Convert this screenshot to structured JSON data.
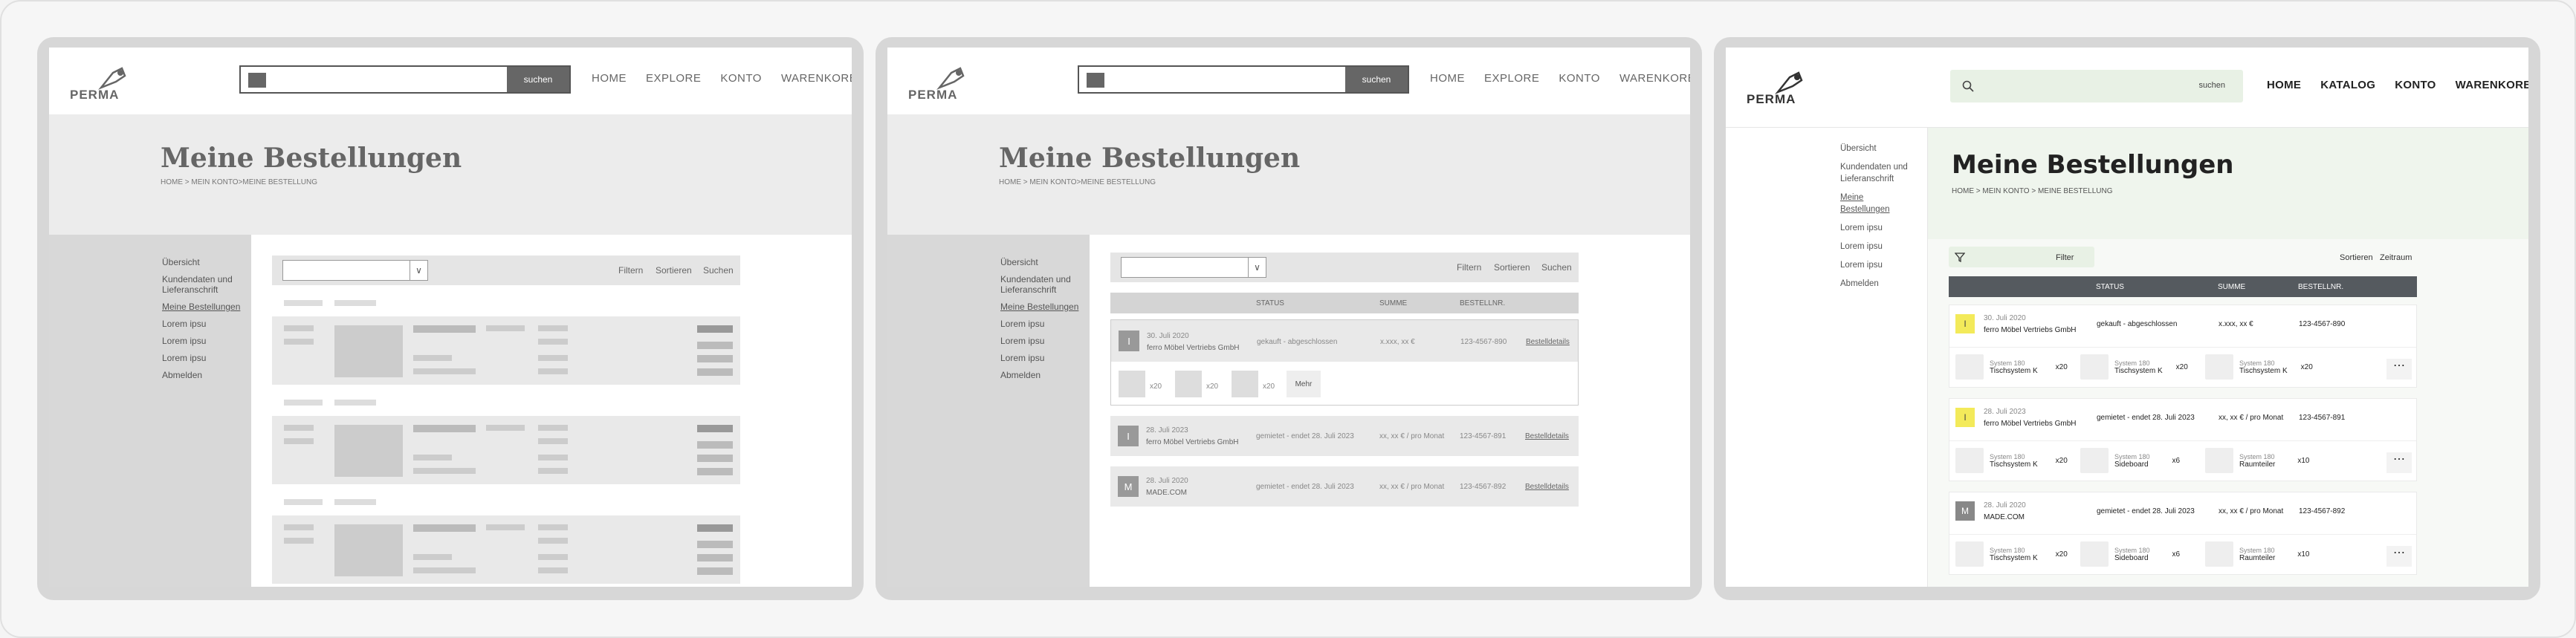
{
  "colors": {
    "accent_green": "#e8f1e5",
    "header_dark": "#555a5f",
    "badge_yellow": "#f3ea5a",
    "badge_gray": "#888888"
  },
  "brand": "PERMA",
  "search": {
    "button": "suchen"
  },
  "nav": [
    "HOME",
    "EXPLORE",
    "KONTO",
    "WARENKORB"
  ],
  "nav_final": [
    "HOME",
    "KATALOG",
    "KONTO",
    "WARENKORB"
  ],
  "page_title": "Meine Bestellungen",
  "breadcrumb": "HOME > MEIN KONTO>MEINE BESTELLUNG",
  "breadcrumb_final": "HOME > MEIN KONTO > MEINE BESTELLUNG",
  "sidebar": {
    "items": [
      "Übersicht",
      "Kundendaten und Lieferanschrift",
      "Meine Bestellungen",
      "Lorem ipsu",
      "Lorem ipsu",
      "Lorem ipsu",
      "Abmelden"
    ]
  },
  "filters": {
    "filter": "Filtern",
    "sort": "Sortieren",
    "search": "Suchen"
  },
  "filters_final": {
    "filter": "Filter",
    "sort": "Sortieren",
    "range": "Zeitraum"
  },
  "table_headers": {
    "status": "STATUS",
    "sum": "SUMME",
    "order_no": "BESTELLNR."
  },
  "orders_mid": [
    {
      "badge": "I",
      "date": "30. Juli 2020",
      "vendor": "ferro Möbel Vertriebs GmbH",
      "status": "gekauft - abgeschlossen",
      "sum": "x.xxx, xx €",
      "nr": "123-4567-890",
      "link": "Bestelldetails",
      "items": [
        "x20",
        "x20",
        "x20"
      ],
      "more": "Mehr"
    },
    {
      "badge": "I",
      "date": "28. Juli 2023",
      "vendor": "ferro Möbel Vertriebs GmbH",
      "status": "gemietet - endet 28. Juli 2023",
      "sum": "xx, xx € / pro Monat",
      "nr": "123-4567-891",
      "link": "Bestelldetails"
    },
    {
      "badge": "M",
      "date": "28. Juli 2020",
      "vendor": "MADE.COM",
      "status": "gemietet - endet 28. Juli 2023",
      "sum": "xx, xx € / pro Monat",
      "nr": "123-4567-892",
      "link": "Bestelldetails"
    }
  ],
  "orders_final": [
    {
      "badge": "I",
      "date": "30. Juli 2020",
      "vendor": "ferro Möbel Vertriebs GmbH",
      "status": "gekauft - abgeschlossen",
      "sum": "x.xxx, xx €",
      "nr": "123-4567-890",
      "products": [
        {
          "series": "System 180",
          "name": "Tischsystem K",
          "qty": "x20"
        },
        {
          "series": "System 180",
          "name": "Tischsystem K",
          "qty": "x20"
        },
        {
          "series": "System 180",
          "name": "Tischsystem K",
          "qty": "x20"
        }
      ]
    },
    {
      "badge": "I",
      "date": "28. Juli 2023",
      "vendor": "ferro Möbel Vertriebs GmbH",
      "status": "gemietet - endet 28. Juli 2023",
      "sum": "xx, xx € / pro Monat",
      "nr": "123-4567-891",
      "products": [
        {
          "series": "System 180",
          "name": "Tischsystem K",
          "qty": "x20"
        },
        {
          "series": "System 180",
          "name": "Sideboard",
          "qty": "x6"
        },
        {
          "series": "System 180",
          "name": "Raumteiler",
          "qty": "x10"
        }
      ]
    },
    {
      "badge": "M",
      "date": "28. Juli 2020",
      "vendor": "MADE.COM",
      "status": "gemietet - endet 28. Juli 2023",
      "sum": "xx, xx € / pro Monat",
      "nr": "123-4567-892",
      "products": [
        {
          "series": "System 180",
          "name": "Tischsystem K",
          "qty": "x20"
        },
        {
          "series": "System 180",
          "name": "Sideboard",
          "qty": "x6"
        },
        {
          "series": "System 180",
          "name": "Raumteiler",
          "qty": "x10"
        }
      ]
    }
  ],
  "more_icon": "more-dots-icon"
}
